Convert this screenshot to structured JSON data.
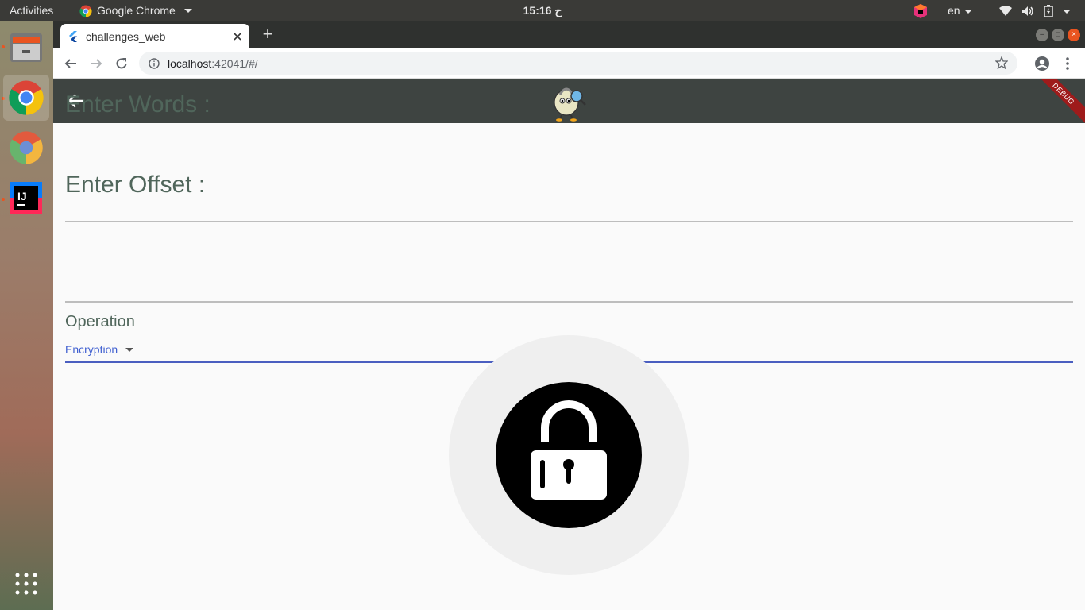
{
  "system_bar": {
    "activities": "Activities",
    "app_menu": "Google Chrome",
    "clock": "15:16 ح",
    "language": "en"
  },
  "dock": {
    "apps": [
      "files-icon",
      "chrome-icon",
      "chromium-icon",
      "intellij-icon"
    ],
    "show_apps": "apps-grid-icon"
  },
  "browser": {
    "tab_title": "challenges_web",
    "new_tab": "+",
    "url_host": "localhost",
    "url_path": ":42041/#/"
  },
  "app": {
    "debug_banner": "DEBUG",
    "words_label": "Enter Words :",
    "words_value": "",
    "offset_label": "Enter Offset :",
    "offset_value": "",
    "operation_label": "Operation",
    "operation_value": "Encryption",
    "colors": {
      "appbar": "#3e4441",
      "label": "#50665b",
      "accent": "#3f5fd0"
    }
  }
}
